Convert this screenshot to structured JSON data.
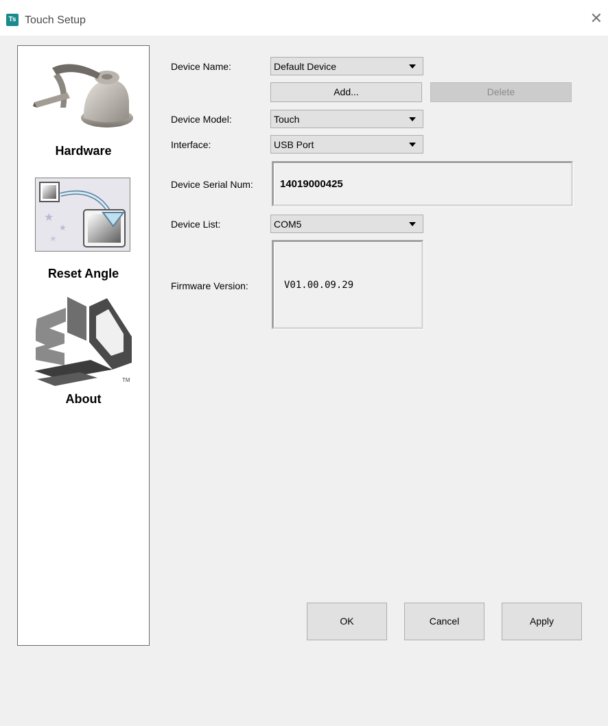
{
  "window": {
    "icon_text": "Ts",
    "title": "Touch Setup",
    "close_glyph": "✕"
  },
  "sidebar": {
    "items": [
      {
        "label": "Hardware",
        "icon": "haptic-device-icon"
      },
      {
        "label": "Reset Angle",
        "icon": "reset-angle-icon"
      },
      {
        "label": "About",
        "icon": "3ds-logo-icon",
        "tm": "TM"
      }
    ]
  },
  "form": {
    "device_name_label": "Device Name:",
    "device_name_value": "Default Device",
    "add_label": "Add...",
    "delete_label": "Delete",
    "device_model_label": "Device Model:",
    "device_model_value": "Touch",
    "interface_label": "Interface:",
    "interface_value": "USB Port",
    "serial_label": "Device Serial Num:",
    "serial_value": "14019000425",
    "device_list_label": "Device List:",
    "device_list_value": "COM5",
    "firmware_label": "Firmware Version:",
    "firmware_value": "V01.00.09.29"
  },
  "buttons": {
    "ok": "OK",
    "cancel": "Cancel",
    "apply": "Apply"
  }
}
